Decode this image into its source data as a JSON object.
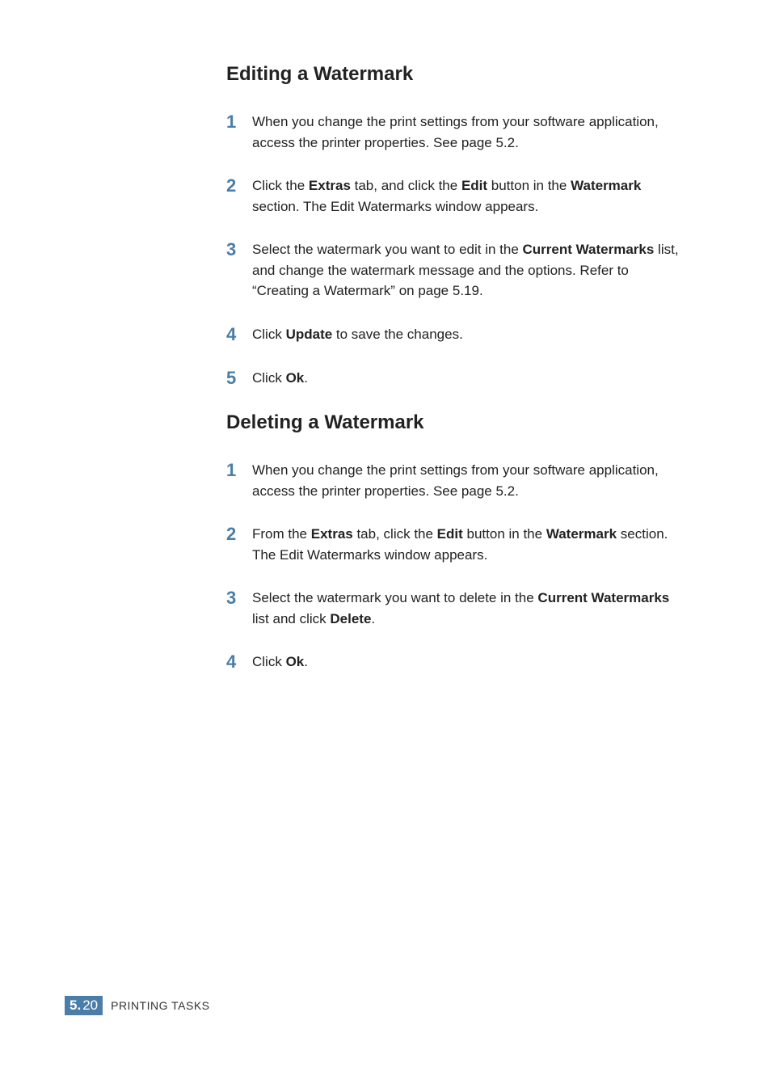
{
  "sections": [
    {
      "heading": "Editing a Watermark",
      "steps": [
        {
          "num": "1",
          "html": "When you change the print settings from your software application, access the printer properties. See page 5.2."
        },
        {
          "num": "2",
          "html": "Click the <strong>Extras</strong> tab, and click the <strong>Edit</strong> button in the <strong>Watermark</strong> section. The Edit Watermarks window appears."
        },
        {
          "num": "3",
          "html": "Select the watermark you want to edit in the <strong>Current Watermarks</strong> list, and change the watermark message and the options. Refer to “Creating a Watermark” on page 5.19."
        },
        {
          "num": "4",
          "html": "Click <strong>Update</strong> to save the changes."
        },
        {
          "num": "5",
          "html": "Click <strong>Ok</strong>."
        }
      ]
    },
    {
      "heading": "Deleting a Watermark",
      "steps": [
        {
          "num": "1",
          "html": "When you change the print settings from your software application, access the printer properties. See page 5.2."
        },
        {
          "num": "2",
          "html": "From the <strong>Extras</strong> tab, click the <strong>Edit</strong> button in the <strong>Watermark</strong> section. The Edit Watermarks window appears."
        },
        {
          "num": "3",
          "html": "Select the watermark you want to delete in the <strong>Current Watermarks</strong> list and click <strong>Delete</strong>."
        },
        {
          "num": "4",
          "html": "Click <strong>Ok</strong>."
        }
      ]
    }
  ],
  "footer": {
    "chapter": "5.",
    "page": "20",
    "label": "PRINTING TASKS"
  }
}
